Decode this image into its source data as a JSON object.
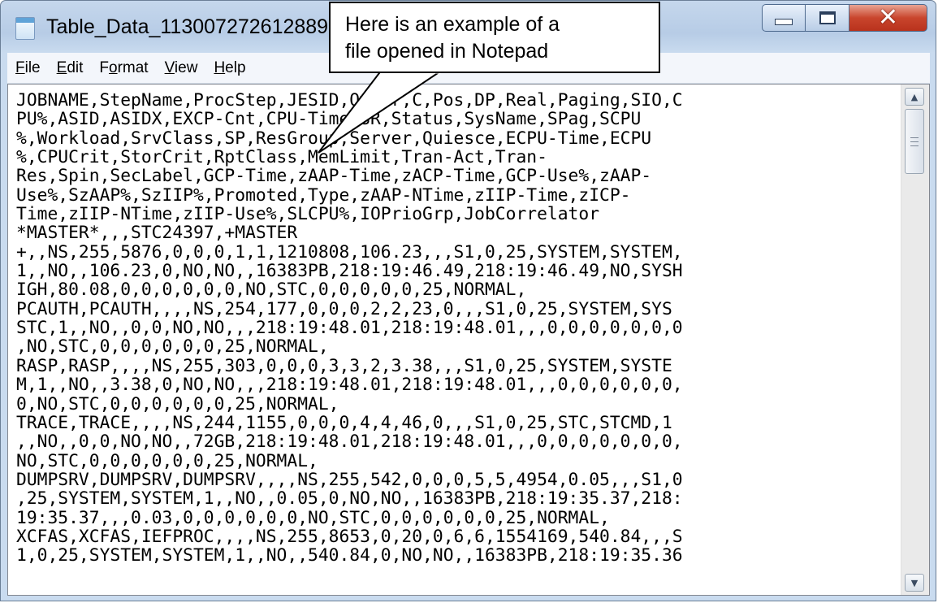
{
  "window": {
    "title": "Table_Data_1130072726128896"
  },
  "menu": [
    {
      "accel": "F",
      "rest": "ile"
    },
    {
      "accel": "E",
      "rest": "dit"
    },
    {
      "pre": "F",
      "accel": "o",
      "rest": "rmat"
    },
    {
      "accel": "V",
      "rest": "iew"
    },
    {
      "accel": "H",
      "rest": "elp"
    }
  ],
  "editor": {
    "lines": [
      "JOBNAME,StepName,ProcStep,JESID,Owner,C,Pos,DP,Real,Paging,SIO,C",
      "PU%,ASID,ASIDX,EXCP-Cnt,CPU-Time,SR,Status,SysName,SPag,SCPU",
      "%,Workload,SrvClass,SP,ResGroup,Server,Quiesce,ECPU-Time,ECPU",
      "%,CPUCrit,StorCrit,RptClass,MemLimit,Tran-Act,Tran-",
      "Res,Spin,SecLabel,GCP-Time,zAAP-Time,zACP-Time,GCP-Use%,zAAP-",
      "Use%,SzAAP%,SzIIP%,Promoted,Type,zAAP-NTime,zIIP-Time,zICP-",
      "Time,zIIP-NTime,zIIP-Use%,SLCPU%,IOPrioGrp,JobCorrelator",
      "*MASTER*,,,STC24397,+MASTER",
      "+,,NS,255,5876,0,0,0,1,1,1210808,106.23,,,S1,0,25,SYSTEM,SYSTEM,",
      "1,,NO,,106.23,0,NO,NO,,16383PB,218:19:46.49,218:19:46.49,NO,SYSH",
      "IGH,80.08,0,0,0,0,0,0,NO,STC,0,0,0,0,0,25,NORMAL,",
      "PCAUTH,PCAUTH,,,,NS,254,177,0,0,0,2,2,23,0,,,S1,0,25,SYSTEM,SYS",
      "STC,1,,NO,,0,0,NO,NO,,,218:19:48.01,218:19:48.01,,,0,0,0,0,0,0,0",
      ",NO,STC,0,0,0,0,0,0,25,NORMAL,",
      "RASP,RASP,,,,NS,255,303,0,0,0,3,3,2,3.38,,,S1,0,25,SYSTEM,SYSTE",
      "M,1,,NO,,3.38,0,NO,NO,,,218:19:48.01,218:19:48.01,,,0,0,0,0,0,0,",
      "0,NO,STC,0,0,0,0,0,0,25,NORMAL,",
      "TRACE,TRACE,,,,NS,244,1155,0,0,0,4,4,46,0,,,S1,0,25,STC,STCMD,1",
      ",,NO,,0,0,NO,NO,,72GB,218:19:48.01,218:19:48.01,,,0,0,0,0,0,0,0,",
      "NO,STC,0,0,0,0,0,0,25,NORMAL,",
      "DUMPSRV,DUMPSRV,DUMPSRV,,,,NS,255,542,0,0,0,5,5,4954,0.05,,,S1,0",
      ",25,SYSTEM,SYSTEM,1,,NO,,0.05,0,NO,NO,,16383PB,218:19:35.37,218:",
      "19:35.37,,,0.03,0,0,0,0,0,0,NO,STC,0,0,0,0,0,0,25,NORMAL,",
      "XCFAS,XCFAS,IEFPROC,,,,NS,255,8653,0,20,0,6,6,1554169,540.84,,,S",
      "1,0,25,SYSTEM,SYSTEM,1,,NO,,540.84,0,NO,NO,,16383PB,218:19:35.36"
    ]
  },
  "callout": {
    "line1": "Here is an example of a",
    "line2": "file opened in Notepad"
  },
  "icons": {
    "app": "notepad-icon",
    "minimize": "minimize-icon",
    "maximize": "maximize-icon",
    "close": "close-icon",
    "scroll_up": "scroll-up-arrow-icon",
    "scroll_down": "scroll-down-arrow-icon"
  },
  "colors": {
    "titlebar": "#b9cde6",
    "close_button": "#c9452d",
    "text": "#000000"
  }
}
